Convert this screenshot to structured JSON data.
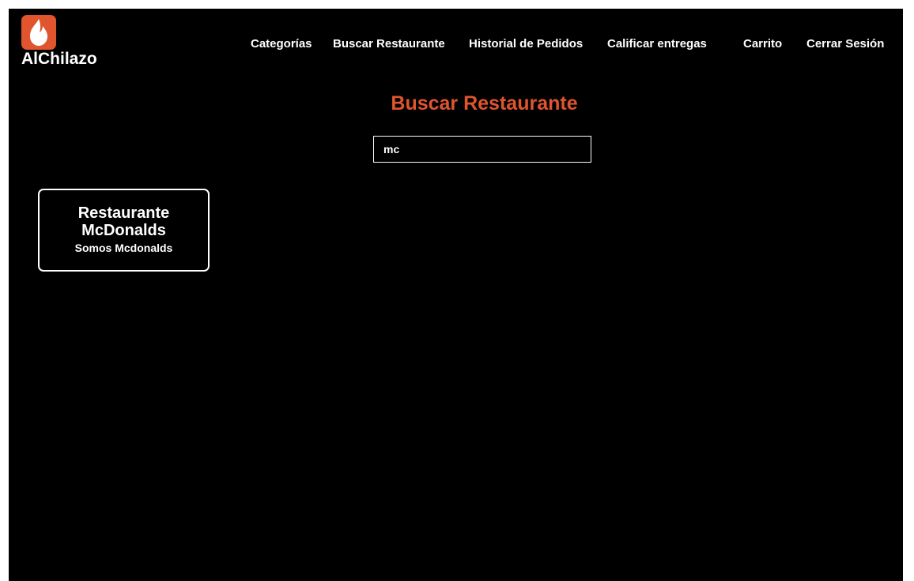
{
  "brand": {
    "name": "AlChilazo",
    "logo_icon": "flame-icon",
    "accent_color": "#e0542e"
  },
  "nav": {
    "items": [
      {
        "label": "Categorías"
      },
      {
        "label": "Buscar Restaurante"
      },
      {
        "label": "Historial de Pedidos"
      },
      {
        "label": "Calificar entregas"
      },
      {
        "label": "Carrito"
      },
      {
        "label": "Cerrar Sesión"
      }
    ]
  },
  "main": {
    "title": "Buscar Restaurante",
    "search": {
      "value": "mc",
      "placeholder": ""
    },
    "results": [
      {
        "name": "Restaurante McDonalds",
        "description": "Somos Mcdonalds"
      }
    ]
  }
}
